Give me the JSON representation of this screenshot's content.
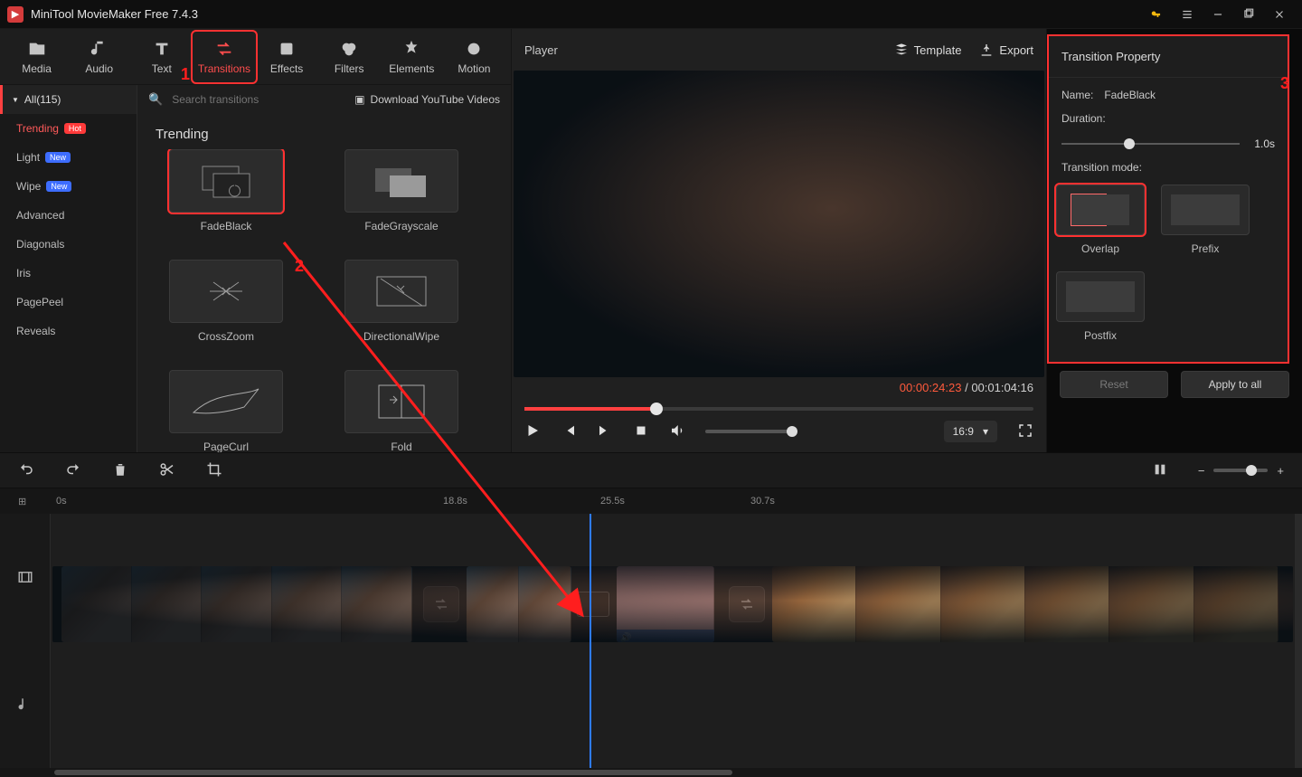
{
  "app": {
    "title": "MiniTool MovieMaker Free 7.4.3"
  },
  "toolbar": {
    "media": "Media",
    "audio": "Audio",
    "text": "Text",
    "transitions": "Transitions",
    "effects": "Effects",
    "filters": "Filters",
    "elements": "Elements",
    "motion": "Motion"
  },
  "sidebar": {
    "all": "All(115)",
    "cats": [
      {
        "label": "Trending",
        "badge": "Hot",
        "active": true
      },
      {
        "label": "Light",
        "badge": "New"
      },
      {
        "label": "Wipe",
        "badge": "New"
      },
      {
        "label": "Advanced"
      },
      {
        "label": "Diagonals"
      },
      {
        "label": "Iris"
      },
      {
        "label": "PagePeel"
      },
      {
        "label": "Reveals"
      }
    ]
  },
  "search": {
    "placeholder": "Search transitions",
    "download": "Download YouTube Videos"
  },
  "grid": {
    "title": "Trending",
    "items": [
      {
        "label": "FadeBlack",
        "selected": true
      },
      {
        "label": "FadeGrayscale"
      },
      {
        "label": "CrossZoom"
      },
      {
        "label": "DirectionalWipe"
      },
      {
        "label": "PageCurl"
      },
      {
        "label": "Fold"
      }
    ]
  },
  "player": {
    "title": "Player",
    "template": "Template",
    "export": "Export",
    "current": "00:00:24:23",
    "total": "00:01:04:16",
    "aspect": "16:9"
  },
  "props": {
    "title": "Transition Property",
    "name_label": "Name:",
    "name_value": "FadeBlack",
    "duration_label": "Duration:",
    "duration_value": "1.0s",
    "mode_label": "Transition mode:",
    "modes": [
      {
        "label": "Overlap",
        "selected": true
      },
      {
        "label": "Prefix"
      },
      {
        "label": "Postfix"
      }
    ],
    "reset": "Reset",
    "apply_all": "Apply to all"
  },
  "annotations": {
    "n1": "1",
    "n2": "2",
    "n3": "3"
  },
  "ruler": {
    "m0": "0s",
    "m1": "18.8s",
    "m2": "25.5s",
    "m3": "30.7s"
  }
}
